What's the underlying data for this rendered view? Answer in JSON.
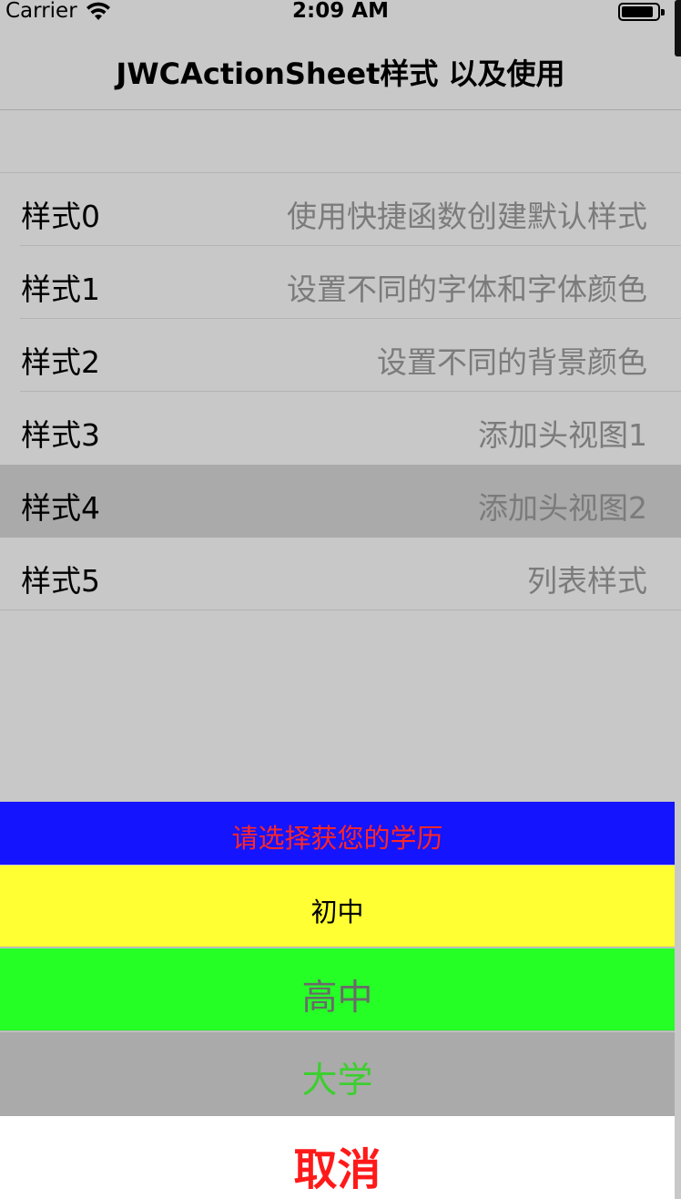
{
  "status_bar": {
    "carrier": "Carrier",
    "time": "2:09 AM",
    "wifi_icon": "wifi-icon",
    "battery_icon": "battery-icon"
  },
  "nav": {
    "title": "JWCActionSheet样式 以及使用"
  },
  "rows": [
    {
      "label": "样式0",
      "detail": "使用快捷函数创建默认样式"
    },
    {
      "label": "样式1",
      "detail": "设置不同的字体和字体颜色"
    },
    {
      "label": "样式2",
      "detail": "设置不同的背景颜色"
    },
    {
      "label": "样式3",
      "detail": "添加头视图1"
    },
    {
      "label": "样式4",
      "detail": "添加头视图2",
      "selected": true
    },
    {
      "label": "样式5",
      "detail": "列表样式"
    }
  ],
  "action_sheet": {
    "title": "请选择获您的学历",
    "options": [
      {
        "label": "初中",
        "background": "#ffff33",
        "color": "#000000"
      },
      {
        "label": "高中",
        "background": "#26ff26",
        "color": "#6a6a6a"
      },
      {
        "label": "大学",
        "background": "#aaaaaa",
        "color": "#3ccf2e"
      }
    ],
    "cancel_label": "取消",
    "title_background": "#1414ff",
    "title_color": "#ff2626",
    "cancel_color": "#ff1a1a"
  },
  "colors": {
    "screen_background": "#c8c8c8",
    "selected_row": "#aaaaaa",
    "detail_text": "#7b7b7b"
  }
}
